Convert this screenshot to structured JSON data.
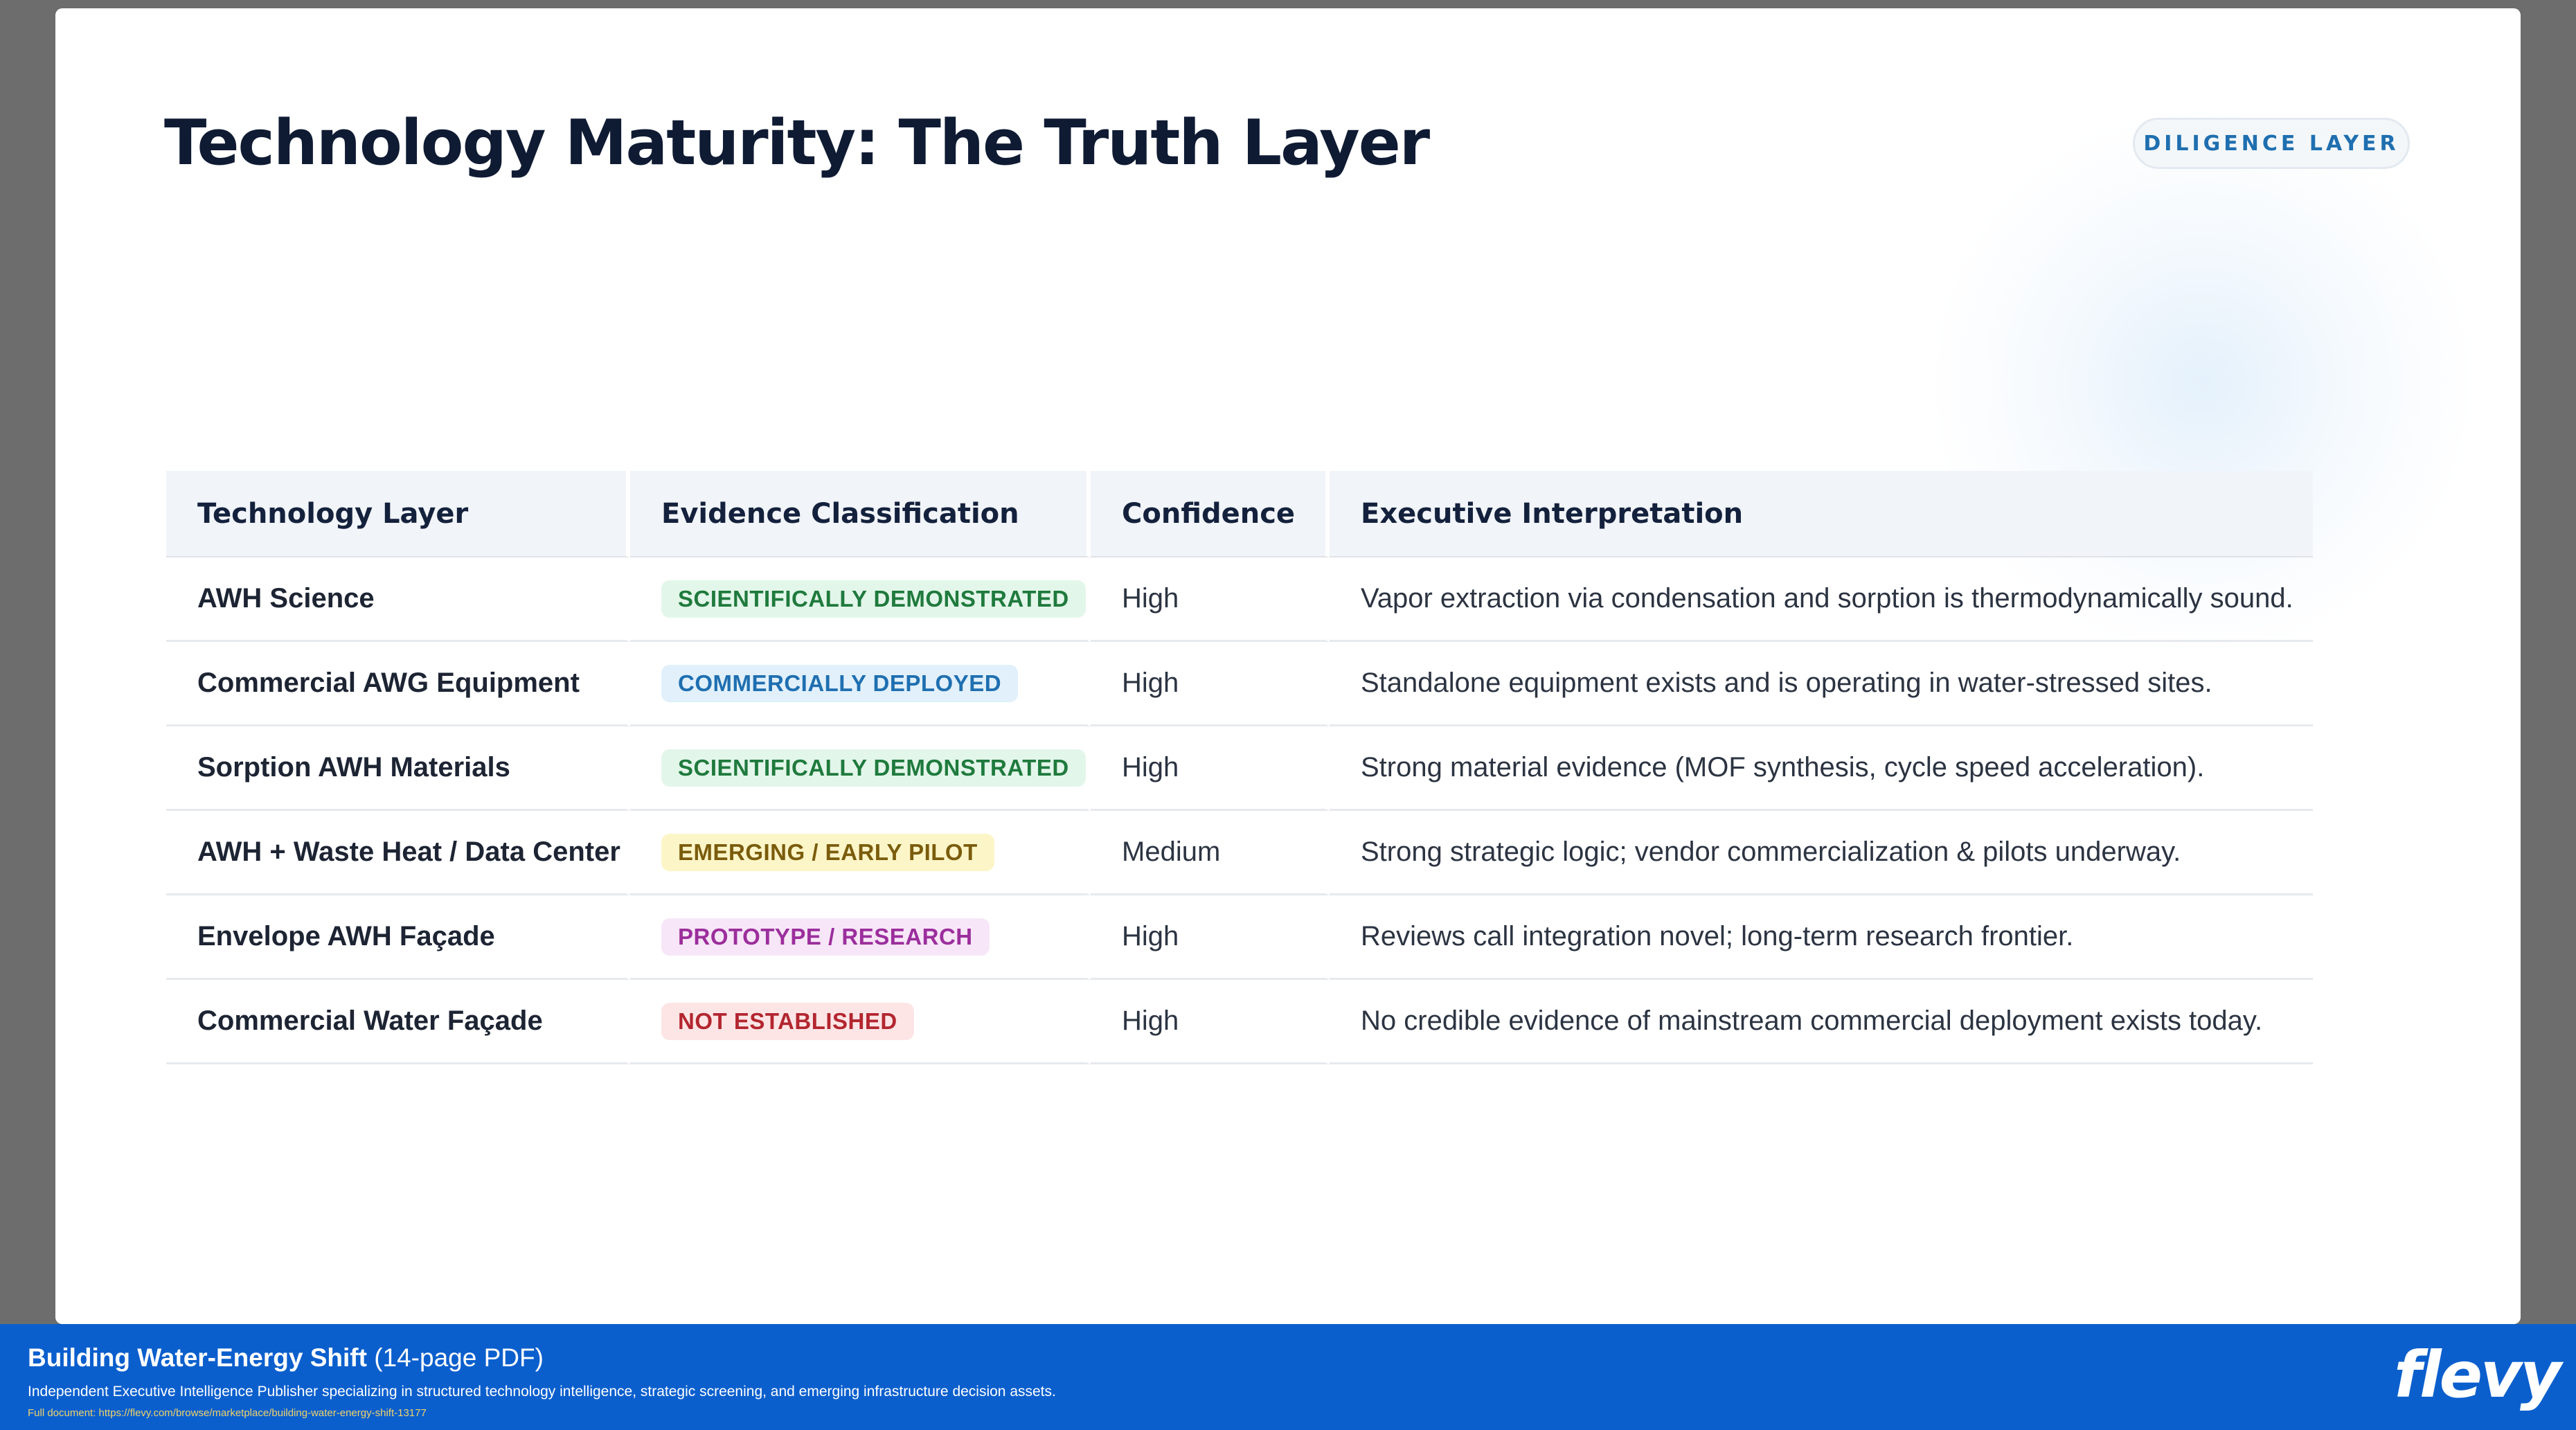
{
  "slide": {
    "title": "Technology Maturity: The Truth Layer",
    "section_tag": "DILIGENCE LAYER"
  },
  "table": {
    "headers": [
      "Technology Layer",
      "Evidence Classification",
      "Confidence",
      "Executive Interpretation"
    ],
    "rows": [
      {
        "layer": "AWH Science",
        "classification": "SCIENTIFICALLY DEMONSTRATED",
        "badge_color": "#1f7a3d",
        "confidence": "High",
        "interpretation": "Vapor extraction via condensation and sorption is thermodynamically sound."
      },
      {
        "layer": "Commercial AWG Equipment",
        "classification": "COMMERCIALLY DEPLOYED",
        "badge_color": "#1f6fb0",
        "confidence": "High",
        "interpretation": "Standalone equipment exists and is operating in water-stressed sites."
      },
      {
        "layer": "Sorption AWH Materials",
        "classification": "SCIENTIFICALLY DEMONSTRATED",
        "badge_color": "#1f7a3d",
        "confidence": "High",
        "interpretation": "Strong material evidence (MOF synthesis, cycle speed acceleration)."
      },
      {
        "layer": "AWH + Waste Heat / Data Center",
        "classification": "EMERGING / EARLY PILOT",
        "badge_color": "#7a5c0c",
        "confidence": "Medium",
        "interpretation": "Strong strategic logic; vendor commercialization & pilots underway."
      },
      {
        "layer": "Envelope AWH Façade",
        "classification": "PROTOTYPE / RESEARCH",
        "badge_color": "#9b2e9c",
        "confidence": "High",
        "interpretation": "Reviews call integration novel; long-term research frontier."
      },
      {
        "layer": "Commercial Water Façade",
        "classification": "NOT ESTABLISHED",
        "badge_color": "#b3262f",
        "confidence": "High",
        "interpretation": "No credible evidence of mainstream commercial deployment exists today."
      }
    ]
  },
  "footer": {
    "doc_title": "Building Water-Energy Shift",
    "doc_meta": "(14-page PDF)",
    "tagline": "Independent Executive Intelligence Publisher specializing in structured technology intelligence, strategic screening, and emerging infrastructure decision assets.",
    "full_doc_label": "Full document: https://flevy.com/browse/marketplace/building-water-energy-shift-13177",
    "logo": "flevy",
    "background_color": "#0b5fcd"
  }
}
